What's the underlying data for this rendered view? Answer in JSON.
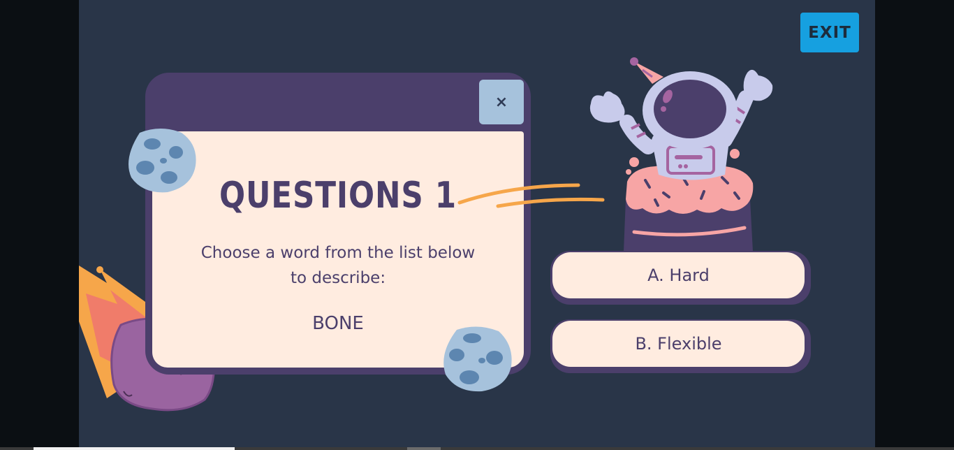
{
  "header": {
    "exit_label": "EXIT"
  },
  "question_window": {
    "close_label": "×",
    "title": "QUESTIONS 1",
    "prompt_line1": "Choose a word from the list below",
    "prompt_line2": "to describe:",
    "word": "BONE"
  },
  "answers": [
    {
      "label": "A. Hard"
    },
    {
      "label": "B. Flexible"
    }
  ],
  "colors": {
    "background": "#293548",
    "accent": "#16a0e0",
    "window": "#4b3f6b",
    "card": "#ffece0",
    "close": "#a6c2dc"
  },
  "icons": {
    "close": "close-icon",
    "astronaut": "astronaut-illustration",
    "meteor": "meteor-illustration",
    "asteroid": "asteroid-illustration"
  }
}
